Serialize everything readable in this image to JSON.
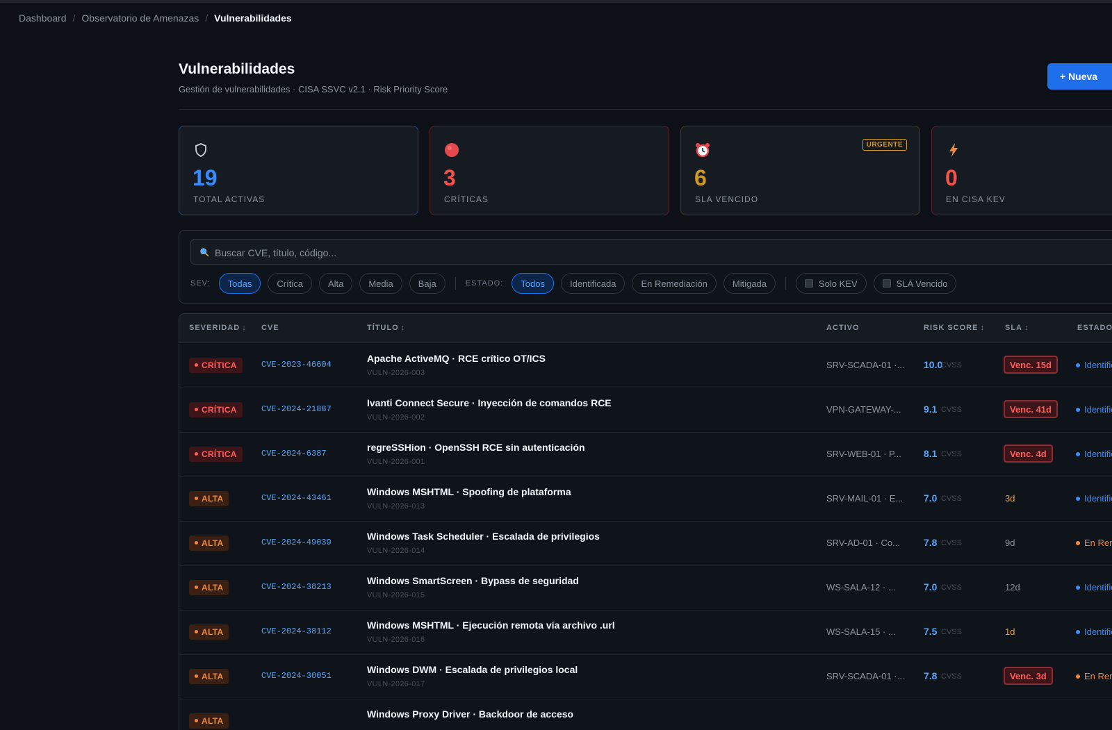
{
  "breadcrumb": {
    "items": [
      "Dashboard",
      "Observatorio de Amenazas"
    ],
    "current": "Vulnerabilidades",
    "separator": "/"
  },
  "header": {
    "title": "Vulnerabilidades",
    "subtitle": "Gestión de vulnerabilidades · CISA SSVC v2.1 · Risk Priority Score",
    "new_button_label": "+ Nueva"
  },
  "stats": [
    {
      "icon": "shield-icon",
      "value": "19",
      "label": "TOTAL ACTIVAS",
      "color": "#388bfd",
      "border": "#1f4b8f"
    },
    {
      "icon": "red-circle-icon",
      "value": "3",
      "label": "CRÍTICAS",
      "color": "#f85149",
      "border": "#5c2326"
    },
    {
      "icon": "alarm-clock-icon",
      "value": "6",
      "label": "SLA VENCIDO",
      "color": "#d29922",
      "border": "#4d3b16",
      "badge": "URGENTE"
    },
    {
      "icon": "lightning-icon",
      "value": "0",
      "label": "EN CISA KEV",
      "color": "#f85149",
      "border": "#5c2326"
    }
  ],
  "search": {
    "placeholder": "Buscar CVE, título, código..."
  },
  "filters": {
    "sev_label": "SEV:",
    "sev_options": [
      "Todas",
      "Crítica",
      "Alta",
      "Media",
      "Baja"
    ],
    "sev_selected": "Todas",
    "estado_label": "ESTADO:",
    "estado_options": [
      "Todos",
      "Identificada",
      "En Remediación",
      "Mitigada"
    ],
    "estado_selected": "Todos",
    "checkboxes": [
      "Solo KEV",
      "SLA Vencido"
    ]
  },
  "table": {
    "columns": [
      {
        "label": "SEVERIDAD",
        "sort": "↓"
      },
      {
        "label": "CVE",
        "sort": ""
      },
      {
        "label": "TÍTULO",
        "sort": "↕"
      },
      {
        "label": "ACTIVO",
        "sort": ""
      },
      {
        "label": "RISK SCORE",
        "sort": "↕"
      },
      {
        "label": "SLA",
        "sort": "↕"
      },
      {
        "label": "ESTADO",
        "sort": ""
      }
    ],
    "cvss_label": "CVSS",
    "rows": [
      {
        "sev": "CRÍTICA",
        "sev_key": "critica",
        "cve": "CVE-2023-46604",
        "title": "Apache ActiveMQ · RCE crítico OT/ICS",
        "code": "VULN-2026-003",
        "asset": "SRV-SCADA-01 ·...",
        "score": "10.0",
        "sla": "Venc. 15d",
        "sla_kind": "overdue",
        "status": "Identificada",
        "status_color": "#388bfd"
      },
      {
        "sev": "CRÍTICA",
        "sev_key": "critica",
        "cve": "CVE-2024-21887",
        "title": "Ivanti Connect Secure · Inyección de comandos RCE",
        "code": "VULN-2026-002",
        "asset": "VPN-GATEWAY-...",
        "score": "9.1",
        "sla": "Venc. 41d",
        "sla_kind": "overdue",
        "status": "Identificada",
        "status_color": "#388bfd"
      },
      {
        "sev": "CRÍTICA",
        "sev_key": "critica",
        "cve": "CVE-2024-6387",
        "title": "regreSSHion · OpenSSH RCE sin autenticación",
        "code": "VULN-2026-001",
        "asset": "SRV-WEB-01 · P...",
        "score": "8.1",
        "sla": "Venc. 4d",
        "sla_kind": "overdue",
        "status": "Identificada",
        "status_color": "#388bfd"
      },
      {
        "sev": "ALTA",
        "sev_key": "alta",
        "cve": "CVE-2024-43461",
        "title": "Windows MSHTML · Spoofing de plataforma",
        "code": "VULN-2026-013",
        "asset": "SRV-MAIL-01 · E...",
        "score": "7.0",
        "sla": "3d",
        "sla_kind": "warn",
        "status": "Identificada",
        "status_color": "#388bfd"
      },
      {
        "sev": "ALTA",
        "sev_key": "alta",
        "cve": "CVE-2024-49039",
        "title": "Windows Task Scheduler · Escalada de privilegios",
        "code": "VULN-2026-014",
        "asset": "SRV-AD-01 · Co...",
        "score": "7.8",
        "sla": "9d",
        "sla_kind": "normal",
        "status": "En Remediación",
        "status_color": "#f0883e"
      },
      {
        "sev": "ALTA",
        "sev_key": "alta",
        "cve": "CVE-2024-38213",
        "title": "Windows SmartScreen · Bypass de seguridad",
        "code": "VULN-2026-015",
        "asset": "WS-SALA-12 · ...",
        "score": "7.0",
        "sla": "12d",
        "sla_kind": "normal",
        "status": "Identificada",
        "status_color": "#388bfd"
      },
      {
        "sev": "ALTA",
        "sev_key": "alta",
        "cve": "CVE-2024-38112",
        "title": "Windows MSHTML · Ejecución remota vía archivo .url",
        "code": "VULN-2026-016",
        "asset": "WS-SALA-15 · ...",
        "score": "7.5",
        "sla": "1d",
        "sla_kind": "warn",
        "status": "Identificada",
        "status_color": "#388bfd"
      },
      {
        "sev": "ALTA",
        "sev_key": "alta",
        "cve": "CVE-2024-30051",
        "title": "Windows DWM · Escalada de privilegios local",
        "code": "VULN-2026-017",
        "asset": "SRV-SCADA-01 ·...",
        "score": "7.8",
        "sla": "Venc. 3d",
        "sla_kind": "overdue",
        "status": "En Remediación",
        "status_color": "#f0883e"
      },
      {
        "sev": "ALTA",
        "sev_key": "alta",
        "cve": "",
        "title": "Windows Proxy Driver · Backdoor de acceso",
        "code": "",
        "asset": "",
        "score": "",
        "sla": "",
        "sla_kind": "overdue",
        "status": "",
        "status_color": "#388bfd"
      }
    ]
  }
}
